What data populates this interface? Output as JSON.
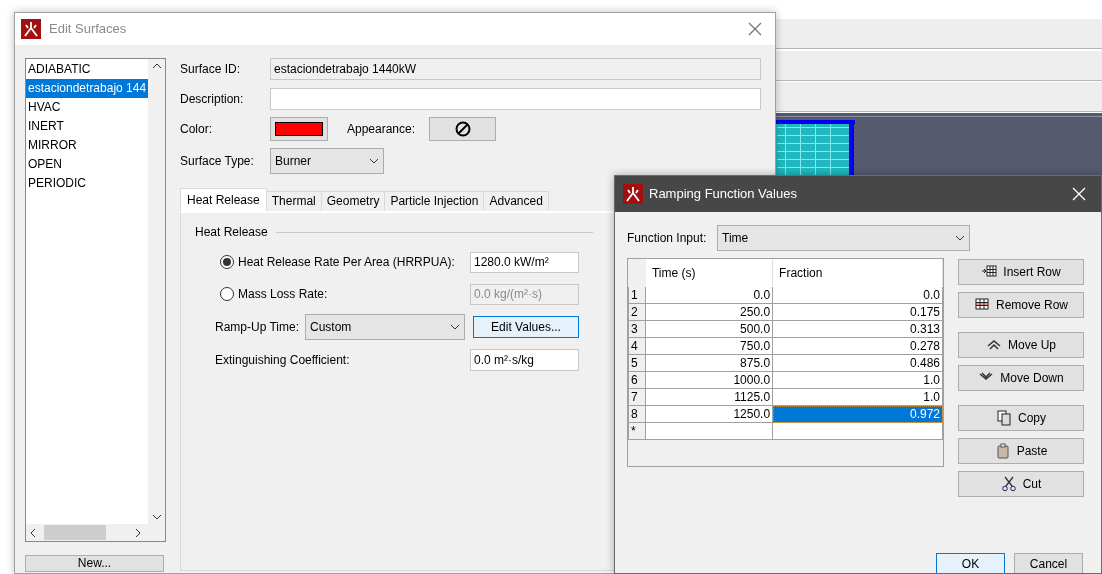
{
  "edit_surfaces": {
    "title": "Edit Surfaces",
    "surfaces": [
      {
        "label": "ADIABATIC",
        "selected": false
      },
      {
        "label": "estaciondetrabajo 144",
        "selected": true
      },
      {
        "label": "HVAC",
        "selected": false
      },
      {
        "label": "INERT",
        "selected": false
      },
      {
        "label": "MIRROR",
        "selected": false
      },
      {
        "label": "OPEN",
        "selected": false
      },
      {
        "label": "PERIODIC",
        "selected": false
      }
    ],
    "new_button": "New...",
    "surface_id_label": "Surface ID:",
    "surface_id": "estaciondetrabajo 1440kW",
    "description_label": "Description:",
    "color_label": "Color:",
    "appearance_label": "Appearance:",
    "surface_type_label": "Surface Type:",
    "surface_type": "Burner",
    "tabs": [
      {
        "label": "Heat Release",
        "selected": true
      },
      {
        "label": "Thermal",
        "selected": false
      },
      {
        "label": "Geometry",
        "selected": false
      },
      {
        "label": "Particle Injection",
        "selected": false
      },
      {
        "label": "Advanced",
        "selected": false
      }
    ],
    "group_title": "Heat Release",
    "options": [
      {
        "label": "Heat Release Rate Per Area (HRRPUA):",
        "selected": true,
        "value": "1280.0 kW/m²",
        "disabled": false
      },
      {
        "label": "Mass Loss Rate:",
        "selected": false,
        "value": "0.0 kg/(m²·s)",
        "disabled": true
      }
    ],
    "ramp_label": "Ramp-Up Time:",
    "ramp_value": "Custom",
    "edit_button": "Edit Values...",
    "ext_label": "Extinguishing Coefficient:",
    "ext_value": "0.0 m²·s/kg"
  },
  "ramping": {
    "title": "Ramping Function Values",
    "function_input_label": "Function Input:",
    "function_input": "Time",
    "columns": [
      "Time (s)",
      "Fraction"
    ],
    "rows": [
      {
        "index": "1",
        "cells": [
          {
            "text": "0.0",
            "selected": false
          },
          {
            "text": "0.0",
            "selected": false
          }
        ]
      },
      {
        "index": "2",
        "cells": [
          {
            "text": "250.0",
            "selected": false
          },
          {
            "text": "0.175",
            "selected": false
          }
        ]
      },
      {
        "index": "3",
        "cells": [
          {
            "text": "500.0",
            "selected": false
          },
          {
            "text": "0.313",
            "selected": false
          }
        ]
      },
      {
        "index": "4",
        "cells": [
          {
            "text": "750.0",
            "selected": false
          },
          {
            "text": "0.278",
            "selected": false
          }
        ]
      },
      {
        "index": "5",
        "cells": [
          {
            "text": "875.0",
            "selected": false
          },
          {
            "text": "0.486",
            "selected": false
          }
        ]
      },
      {
        "index": "6",
        "cells": [
          {
            "text": "1000.0",
            "selected": false
          },
          {
            "text": "1.0",
            "selected": false
          }
        ]
      },
      {
        "index": "7",
        "cells": [
          {
            "text": "1125.0",
            "selected": false
          },
          {
            "text": "1.0",
            "selected": false
          }
        ]
      },
      {
        "index": "8",
        "cells": [
          {
            "text": "1250.0",
            "selected": false
          },
          {
            "text": "0.972",
            "selected": true
          }
        ]
      }
    ],
    "new_row_marker": "*",
    "button_groups": [
      [
        {
          "label": "Insert Row",
          "kind": "insert"
        },
        {
          "label": "Remove Row",
          "kind": "remove"
        }
      ],
      [
        {
          "label": "Move Up",
          "kind": "up"
        },
        {
          "label": "Move Down",
          "kind": "down"
        }
      ],
      [
        {
          "label": "Copy",
          "kind": "copy"
        },
        {
          "label": "Paste",
          "kind": "paste"
        },
        {
          "label": "Cut",
          "kind": "cut"
        }
      ]
    ],
    "dialog_buttons": [
      {
        "label": "OK",
        "default": true
      },
      {
        "label": "Cancel",
        "default": false
      }
    ]
  }
}
